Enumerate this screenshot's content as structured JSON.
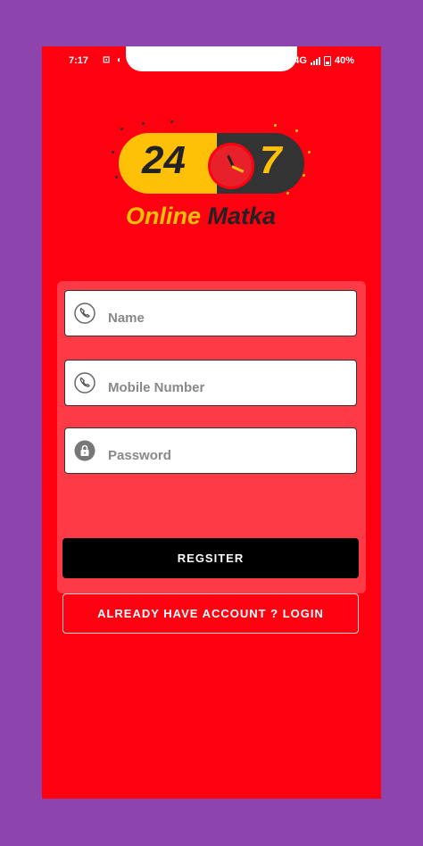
{
  "status_bar": {
    "time": "7:17",
    "network": "4G",
    "battery": "40%"
  },
  "logo": {
    "number_left": "24",
    "number_right": "7",
    "text_online": "Online",
    "text_matka": "Matka"
  },
  "form": {
    "name_placeholder": "Name",
    "mobile_placeholder": "Mobile Number",
    "password_placeholder": "Password",
    "register_label": "REGSITER",
    "login_label": "ALREADY HAVE ACCOUNT ? LOGIN"
  },
  "colors": {
    "background": "#8e44ad",
    "screen": "#ff0010",
    "card": "#ff3a47",
    "accent_yellow": "#ffc107",
    "dark": "#333333",
    "button": "#000000"
  },
  "icons": {
    "name_field": "phone-icon",
    "mobile_field": "phone-icon",
    "password_field": "lock-icon"
  }
}
